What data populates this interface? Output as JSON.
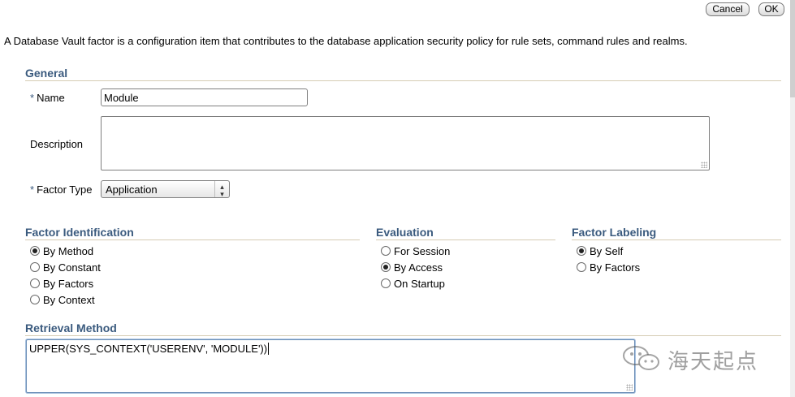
{
  "buttons": {
    "cancel": "Cancel",
    "ok": "OK"
  },
  "intro": "A Database Vault factor is a configuration item that contributes to the database application security policy for rule sets, command rules and realms.",
  "general": {
    "title": "General",
    "name_label": "Name",
    "name_value": "Module",
    "description_label": "Description",
    "description_value": "",
    "factor_type_label": "Factor Type",
    "factor_type_value": "Application",
    "required_mark": "*"
  },
  "factor_identification": {
    "title": "Factor Identification",
    "options": [
      "By Method",
      "By Constant",
      "By Factors",
      "By Context"
    ],
    "selected": "By Method"
  },
  "evaluation": {
    "title": "Evaluation",
    "options": [
      "For Session",
      "By Access",
      "On Startup"
    ],
    "selected": "By Access"
  },
  "factor_labeling": {
    "title": "Factor Labeling",
    "options": [
      "By Self",
      "By Factors"
    ],
    "selected": "By Self"
  },
  "retrieval": {
    "title": "Retrieval Method",
    "value": "UPPER(SYS_CONTEXT('USERENV', 'MODULE'))"
  },
  "watermark": {
    "text": "海天起点",
    "icon": "wechat-logo-icon"
  }
}
